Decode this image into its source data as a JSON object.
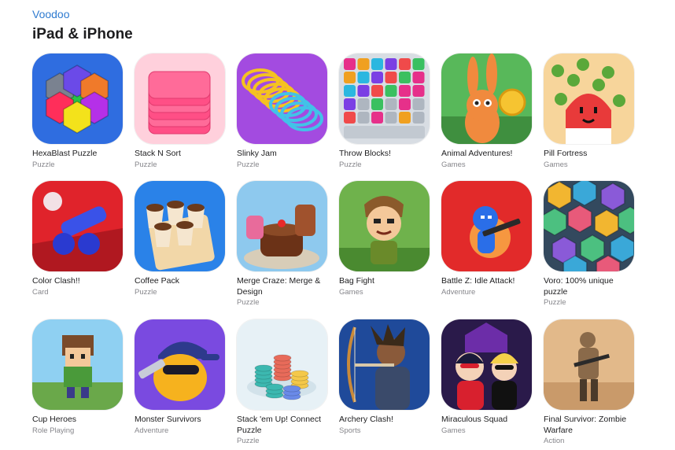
{
  "developer": {
    "name": "Voodoo"
  },
  "section": {
    "title": "iPad & iPhone"
  },
  "apps": [
    {
      "name": "HexaBlast Puzzle",
      "category": "Puzzle",
      "icon": "hexagon-puzzle-icon",
      "colors": [
        "#2f6de0",
        "#ff2e5a",
        "#26c24a",
        "#f3e21b",
        "#b530e8"
      ]
    },
    {
      "name": "Stack N Sort",
      "category": "Puzzle",
      "icon": "pink-stack-icon",
      "colors": [
        "#ff4f86",
        "#ffd0dc"
      ]
    },
    {
      "name": "Slinky Jam",
      "category": "Puzzle",
      "icon": "slinky-icon",
      "colors": [
        "#a34be0",
        "#f5c220",
        "#42c2e8"
      ]
    },
    {
      "name": "Throw Blocks!",
      "category": "Puzzle",
      "icon": "number-blocks-icon",
      "colors": [
        "#d8dde3",
        "#e6308a",
        "#7b3fe4",
        "#2bb7e0"
      ]
    },
    {
      "name": "Animal Adventures!",
      "category": "Games",
      "icon": "bunny-coin-icon",
      "colors": [
        "#58b85a",
        "#f08a3e",
        "#f6c431"
      ]
    },
    {
      "name": "Pill Fortress",
      "category": "Games",
      "icon": "pill-virus-icon",
      "colors": [
        "#f7d59b",
        "#e83a3a",
        "#5aa83a"
      ]
    },
    {
      "name": "Color Clash!!",
      "category": "Card",
      "icon": "blue-cannon-icon",
      "colors": [
        "#e0232b",
        "#3a52e8"
      ]
    },
    {
      "name": "Coffee Pack",
      "category": "Puzzle",
      "icon": "coffee-cups-icon",
      "colors": [
        "#2a82e8",
        "#f2d7a8",
        "#6a3a1c"
      ]
    },
    {
      "name": "Merge Craze: Merge & Design",
      "category": "Puzzle",
      "icon": "cakes-icon",
      "colors": [
        "#8ec9ee",
        "#6b3217",
        "#e86b9b"
      ]
    },
    {
      "name": "Bag Fight",
      "category": "Games",
      "icon": "warrior-hero-icon",
      "colors": [
        "#6fb24c",
        "#8b5a2b",
        "#f4c89a"
      ]
    },
    {
      "name": "Battle Z: Idle Attack!",
      "category": "Adventure",
      "icon": "blue-soldier-icon",
      "colors": [
        "#e22a2a",
        "#2a6ee8",
        "#ffc64a"
      ]
    },
    {
      "name": "Voro: 100% unique puzzle",
      "category": "Puzzle",
      "icon": "voronoi-cells-icon",
      "colors": [
        "#f2b630",
        "#3aa8d8",
        "#8a5ad8",
        "#4cc080",
        "#e85a7a"
      ]
    },
    {
      "name": "Cup Heroes",
      "category": "Role Playing",
      "icon": "pixel-hero-icon",
      "colors": [
        "#8fd0f2",
        "#7a4a2a",
        "#4a9a3a"
      ]
    },
    {
      "name": "Monster Survivors",
      "category": "Adventure",
      "icon": "cap-shooter-icon",
      "colors": [
        "#7a4ae0",
        "#f6b21e",
        "#2d3a8c"
      ]
    },
    {
      "name": "Stack 'em Up! Connect Puzzle",
      "category": "Puzzle",
      "icon": "chip-stacks-icon",
      "colors": [
        "#e7f1f6",
        "#3cb8b0",
        "#e86b5a",
        "#f4c84a"
      ]
    },
    {
      "name": "Archery Clash!",
      "category": "Sports",
      "icon": "archer-icon",
      "colors": [
        "#1f4a9a",
        "#c98a3a",
        "#3a2a1a"
      ]
    },
    {
      "name": "Miraculous Squad",
      "category": "Games",
      "icon": "ladybug-catnoir-icon",
      "colors": [
        "#2a1a4a",
        "#d8202e",
        "#9a3ae8"
      ]
    },
    {
      "name": "Final Survivor: Zombie Warfare",
      "category": "Action",
      "icon": "desert-soldier-icon",
      "colors": [
        "#e2b98a",
        "#8a6a4a",
        "#4a3a2a"
      ]
    }
  ]
}
